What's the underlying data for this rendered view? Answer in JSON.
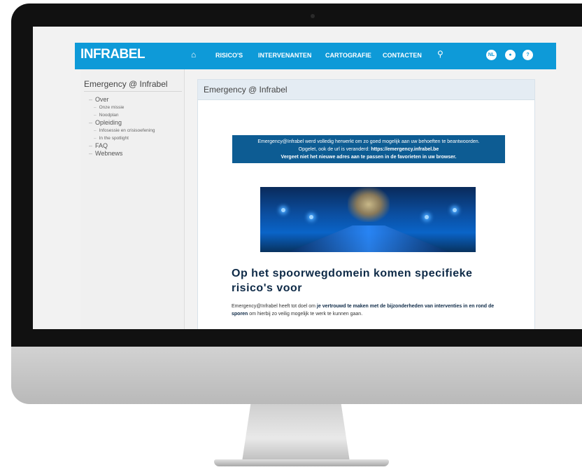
{
  "navbar": {
    "logo": "INFRABEL",
    "items": [
      "RISICO'S",
      "INTERVENANTEN",
      "CARTOGRAFIE",
      "CONTACTEN"
    ],
    "lang": "NL",
    "accent": "#0e9ad8"
  },
  "sidebar": {
    "title": "Emergency @ Infrabel",
    "items": [
      {
        "label": "Over",
        "level": 1
      },
      {
        "label": "Onze missie",
        "level": 2
      },
      {
        "label": "Noodplan",
        "level": 2
      },
      {
        "label": "Opleiding",
        "level": 1
      },
      {
        "label": "Infosessie en crisisoefening",
        "level": 2
      },
      {
        "label": "In the spotlight",
        "level": 2
      },
      {
        "label": "FAQ",
        "level": 1
      },
      {
        "label": "Webnews",
        "level": 1
      }
    ]
  },
  "panel": {
    "title": "Emergency @ Infrabel",
    "notice": {
      "line1": "Emergency@Infrabel werd volledig herwerkt om zo goed mogelijk aan uw behoeften te beantwoorden.",
      "line2_prefix": "Opgelet, ook de url is veranderd: ",
      "line2_url": "https://emergency.infrabel.be",
      "line3": "Vergeet niet het nieuwe adres aan te passen in de favorieten in uw browser."
    },
    "headline": "Op het spoorwegdomein komen specifieke risico's voor",
    "body": {
      "part1": "Emergency@Infrabel heeft tot doel om ",
      "bold": "je vertrouwd te maken met de bijzonderheden van interventies in en rond de sporen",
      "part2": " om hierbij zo veilig mogelijk te werk te kunnen gaan."
    }
  }
}
